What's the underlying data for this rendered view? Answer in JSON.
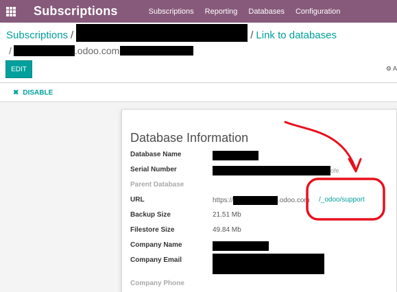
{
  "navbar": {
    "brand": "Subscriptions",
    "menu": [
      "Subscriptions",
      "Reporting",
      "Databases",
      "Configuration"
    ]
  },
  "breadcrumb": {
    "root": "Subscriptions",
    "sep1": "/",
    "sep2": "/",
    "current": "Link to databases",
    "line2_prefix": "/",
    "line2_domain": ".odoo.com"
  },
  "buttons": {
    "edit": "EDIT",
    "action": "A",
    "disable": "DISABLE"
  },
  "sheet": {
    "title": "Database Information",
    "fields": {
      "database_name": {
        "label": "Database Name"
      },
      "serial_number": {
        "label": "Serial Number",
        "suffix": "ofe"
      },
      "parent_database": {
        "label": "Parent Database"
      },
      "url": {
        "label": "URL",
        "prefix": "https://",
        "domain": ".odoo.com",
        "support_link": "/_odoo/support"
      },
      "backup_size": {
        "label": "Backup Size",
        "value": "21.51 Mb"
      },
      "filestore_size": {
        "label": "Filestore Size",
        "value": "49.84 Mb"
      },
      "company_name": {
        "label": "Company Name"
      },
      "company_email": {
        "label": "Company Email"
      },
      "company_phone": {
        "label": "Company Phone"
      }
    }
  },
  "colors": {
    "navbar": "#875a7b",
    "accent": "#00a09d",
    "annotation": "#e8101d"
  },
  "icons": [
    "apps-grid-icon",
    "close-icon",
    "gear-icon"
  ]
}
